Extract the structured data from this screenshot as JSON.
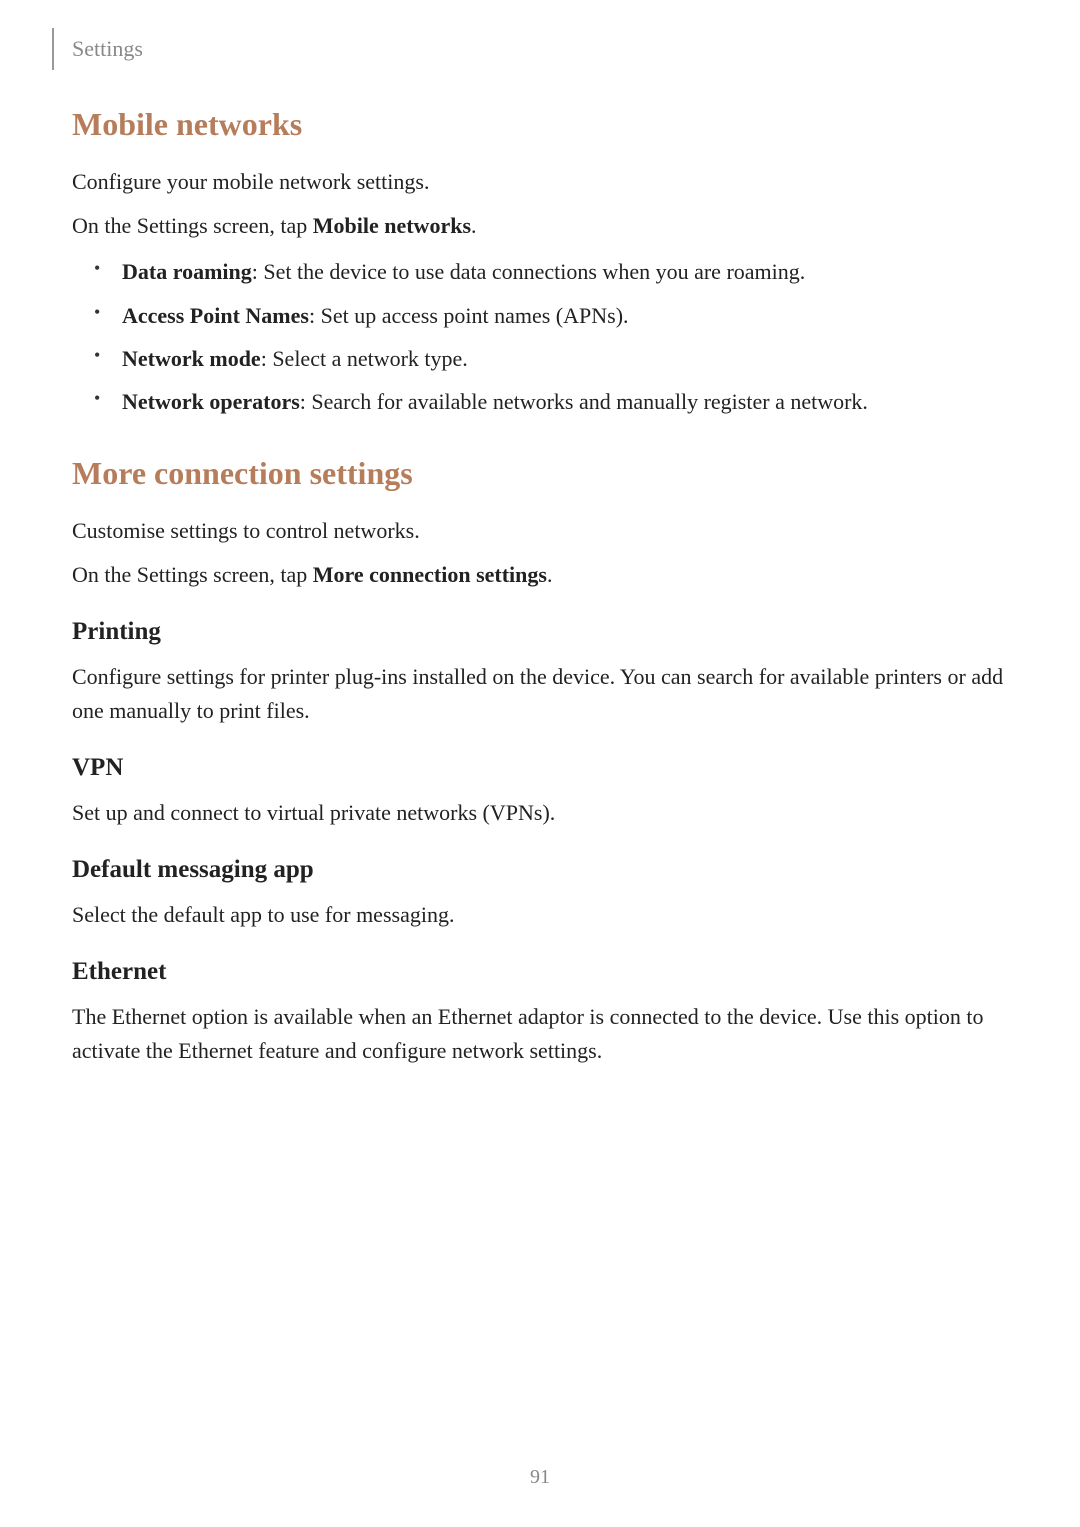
{
  "header": {
    "breadcrumb": "Settings"
  },
  "mobile_networks": {
    "title": "Mobile networks",
    "intro": "Configure your mobile network settings.",
    "instruction_prefix": "On the Settings screen, tap ",
    "instruction_bold": "Mobile networks",
    "instruction_suffix": ".",
    "items": [
      {
        "label": "Data roaming",
        "desc": ": Set the device to use data connections when you are roaming."
      },
      {
        "label": "Access Point Names",
        "desc": ": Set up access point names (APNs)."
      },
      {
        "label": "Network mode",
        "desc": ": Select a network type."
      },
      {
        "label": "Network operators",
        "desc": ": Search for available networks and manually register a network."
      }
    ]
  },
  "more_connection": {
    "title": "More connection settings",
    "intro": "Customise settings to control networks.",
    "instruction_prefix": "On the Settings screen, tap ",
    "instruction_bold": "More connection settings",
    "instruction_suffix": ".",
    "subsections": {
      "printing": {
        "title": "Printing",
        "body": "Configure settings for printer plug-ins installed on the device. You can search for available printers or add one manually to print files."
      },
      "vpn": {
        "title": "VPN",
        "body": "Set up and connect to virtual private networks (VPNs)."
      },
      "default_messaging": {
        "title": "Default messaging app",
        "body": "Select the default app to use for messaging."
      },
      "ethernet": {
        "title": "Ethernet",
        "body": "The Ethernet option is available when an Ethernet adaptor is connected to the device. Use this option to activate the Ethernet feature and configure network settings."
      }
    }
  },
  "page_number": "91"
}
